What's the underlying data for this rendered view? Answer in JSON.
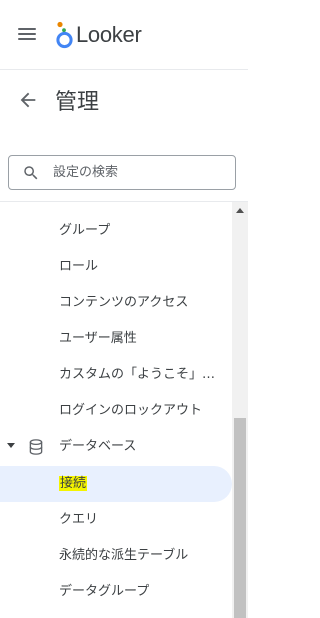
{
  "app": {
    "logo_text": "Looker",
    "brand_colors": {
      "orange": "#ea8600",
      "blue": "#4285f4",
      "green": "#34a853",
      "yellow": "#fbbc04"
    }
  },
  "page": {
    "title": "管理"
  },
  "search": {
    "placeholder": "設定の検索",
    "value": ""
  },
  "nav": {
    "items": [
      {
        "label": "グループ"
      },
      {
        "label": "ロール"
      },
      {
        "label": "コンテンツのアクセス"
      },
      {
        "label": "ユーザー属性"
      },
      {
        "label": "カスタムの「ようこそ」…"
      },
      {
        "label": "ログインのロックアウト"
      },
      {
        "label": "データベース",
        "expanded": true,
        "icon": "database-icon"
      },
      {
        "label": "接続",
        "active": true,
        "highlight_color": "#f4f400"
      },
      {
        "label": "クエリ"
      },
      {
        "label": "永続的な派生テーブル"
      },
      {
        "label": "データグループ"
      }
    ]
  },
  "colors": {
    "active_bg": "#e8f0fe",
    "text": "#3c4043",
    "icon": "#5f6368"
  }
}
